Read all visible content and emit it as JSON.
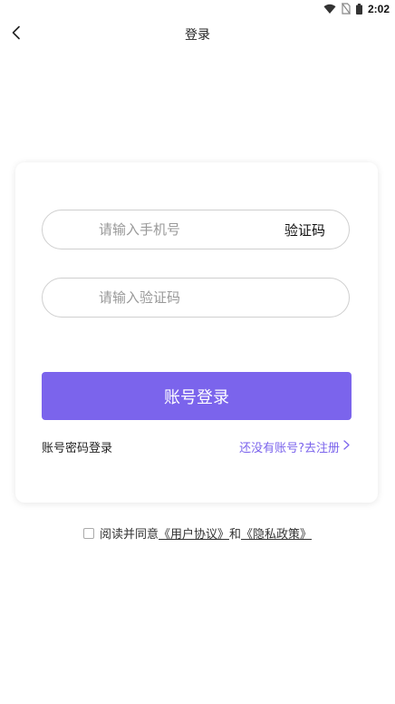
{
  "status_bar": {
    "time": "2:02",
    "icons": [
      "wifi-icon",
      "no-sim-icon",
      "battery-icon"
    ]
  },
  "nav": {
    "title": "登录",
    "back_icon": "chevron-left-icon"
  },
  "form": {
    "phone_placeholder": "请输入手机号",
    "get_code_label": "验证码",
    "code_placeholder": "请输入验证码",
    "login_button": "账号登录",
    "password_login_link": "账号密码登录",
    "register_link": "还没有账号?去注册",
    "register_icon": "chevron-right-icon"
  },
  "agreement": {
    "prefix": "阅读并同意",
    "user_agreement": "《用户协议》",
    "conjunction": "和",
    "privacy_policy": "《隐私政策》",
    "checked": false
  },
  "colors": {
    "accent": "#7b64ec"
  }
}
